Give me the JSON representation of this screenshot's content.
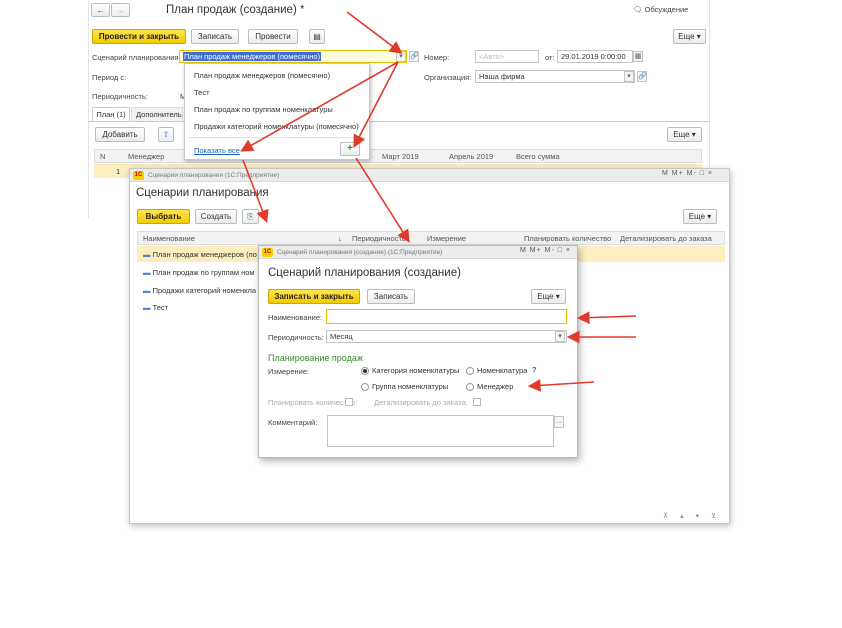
{
  "main_form": {
    "title": "План продаж (создание) *",
    "discussion": "Обсуждение",
    "post_close": "Провести и закрыть",
    "save": "Записать",
    "post": "Провести",
    "more": "Еще",
    "scenario_label": "Сценарий планирования:",
    "scenario_value": "План продаж менеджеров (помесячно)",
    "number_label": "Номер:",
    "number_placeholder": "<Авто>",
    "date_label": "от:",
    "date_value": "29.01.2019  0:00:00",
    "period_label": "Период с:",
    "org_label": "Организация:",
    "org_value": "Наша фирма",
    "periodicity_label": "Периодичность:",
    "periodicity_value": "М",
    "tab_plan": "План (1)",
    "tab_extra": "Дополнитель",
    "add": "Добавить",
    "more2": "Еще",
    "columns": [
      "N",
      "Менеджер",
      "Март 2019",
      "Апрель 2019",
      "Всего сумма"
    ],
    "row_num": "1"
  },
  "dropdown": {
    "items": [
      "План продаж менеджеров (помесячно)",
      "Тест",
      "План продаж по группам номенклатуры",
      "Продажи категорий номенклатуры (помесячно)"
    ],
    "show_all": "Показать все"
  },
  "list_window": {
    "caption": "Сценарии планирования  (1С:Предприятие)",
    "controls": [
      "M",
      "M+",
      "M-"
    ],
    "title": "Сценарии планирования",
    "select": "Выбрать",
    "create": "Создать",
    "more": "Еще",
    "columns": [
      "Наименование",
      "Периодичность",
      "Измерение",
      "Планировать количество",
      "Детализировать до заказа"
    ],
    "rows": [
      "План продаж менеджеров (по",
      "План продаж по группам ном",
      "Продажи категорий номенкла",
      "Тест"
    ]
  },
  "create_window": {
    "caption": "Сценарий планирования (создание)  (1С:Предприятие)",
    "title": "Сценарий планирования (создание)",
    "save_close": "Записать и закрыть",
    "save": "Записать",
    "more": "Еще",
    "name_label": "Наименование:",
    "periodicity_label": "Периодичность:",
    "periodicity_value": "Месяц",
    "section": "Планирование продаж",
    "dimension_label": "Измерение:",
    "radios": [
      "Категория номенклатуры",
      "Номенклатура",
      "Группа номенклатуры",
      "Менеджер"
    ],
    "help": "?",
    "plan_qty_label": "Планировать количество:",
    "detail_label": "Детализировать до заказа:",
    "comment_label": "Комментарий:",
    "ellipsis": "..."
  },
  "colors": {
    "accent": "#f5d000",
    "arrow": "#e03a2b",
    "link": "#1a5fb4",
    "section": "#3a8a2e"
  }
}
